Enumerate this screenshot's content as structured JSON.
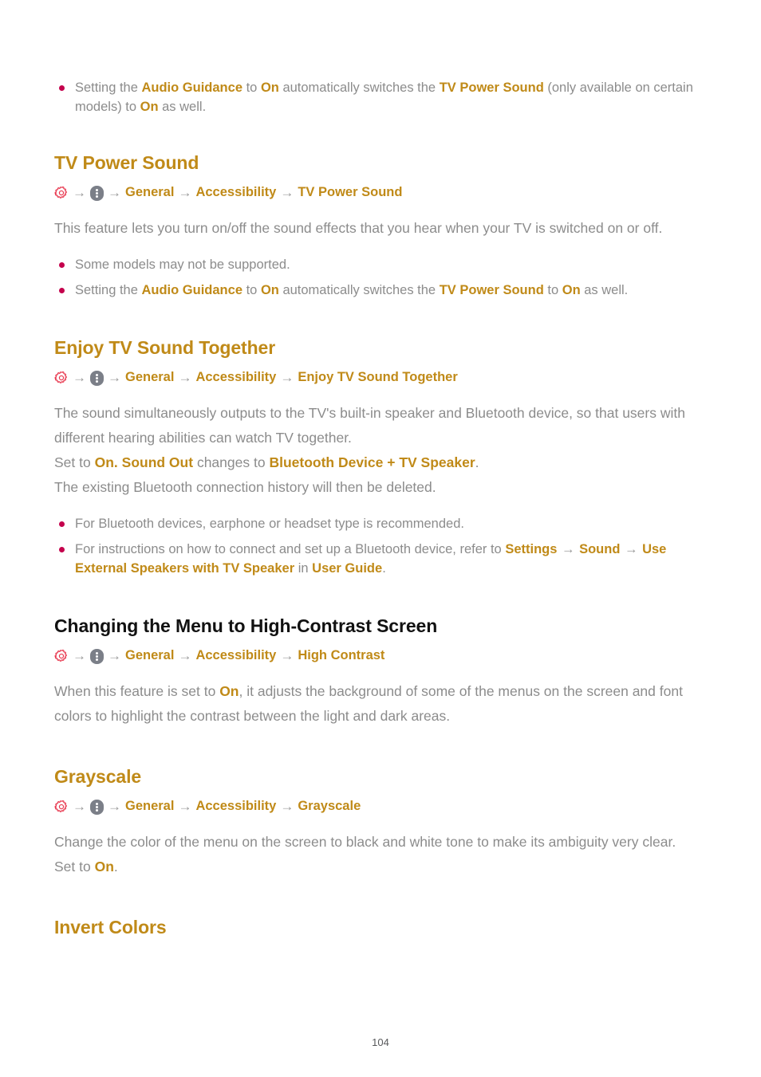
{
  "page": {
    "number": "104",
    "accent_gold": "#c08a18",
    "body_gray": "#8c8c8c",
    "bullet_crimson": "#c4004c",
    "gear_red": "#e8384f",
    "more_gray": "#7b7f88",
    "heading_black": "#111111"
  },
  "icons": {
    "gear": "gear-icon",
    "more": "more-vertical-icon",
    "arrow": "→"
  },
  "intro_bullets": [
    {
      "parts": [
        {
          "t": "Setting the ",
          "b": false
        },
        {
          "t": "Audio Guidance",
          "b": true
        },
        {
          "t": " to ",
          "b": false
        },
        {
          "t": "On",
          "b": true
        },
        {
          "t": " automatically switches the ",
          "b": false
        },
        {
          "t": "TV Power Sound",
          "b": true
        },
        {
          "t": " (only available on certain models) to ",
          "b": false
        },
        {
          "t": "On",
          "b": true
        },
        {
          "t": " as well.",
          "b": false
        }
      ]
    }
  ],
  "sections": [
    {
      "id": "tv-power-sound",
      "title": "TV Power Sound",
      "title_color": "gold",
      "breadcrumb": [
        "General",
        "Accessibility",
        "TV Power Sound"
      ],
      "paragraph": [
        {
          "t": "This feature lets you turn on/off the sound effects that you hear when your TV is switched on or off.",
          "b": false
        }
      ],
      "bullets": [
        {
          "parts": [
            {
              "t": "Some models may not be supported.",
              "b": false
            }
          ]
        },
        {
          "parts": [
            {
              "t": "Setting the ",
              "b": false
            },
            {
              "t": "Audio Guidance",
              "b": true
            },
            {
              "t": " to ",
              "b": false
            },
            {
              "t": "On",
              "b": true
            },
            {
              "t": " automatically switches the ",
              "b": false
            },
            {
              "t": "TV Power Sound",
              "b": true
            },
            {
              "t": " to ",
              "b": false
            },
            {
              "t": "On",
              "b": true
            },
            {
              "t": " as well.",
              "b": false
            }
          ]
        }
      ]
    },
    {
      "id": "enjoy-tv-sound-together",
      "title": "Enjoy TV Sound Together",
      "title_color": "gold",
      "breadcrumb": [
        "General",
        "Accessibility",
        "Enjoy TV Sound Together"
      ],
      "paragraph": [
        {
          "t": "The sound simultaneously outputs to the TV's built-in speaker and Bluetooth device, so that users with different hearing abilities can watch TV together.",
          "b": false
        },
        {
          "t": "\n",
          "b": false
        },
        {
          "t": "Set to ",
          "b": false
        },
        {
          "t": "On.",
          "b": true
        },
        {
          "t": " ",
          "b": false
        },
        {
          "t": "Sound Out",
          "b": true
        },
        {
          "t": " changes to ",
          "b": false
        },
        {
          "t": "Bluetooth Device + TV Speaker",
          "b": true
        },
        {
          "t": ".",
          "b": false
        },
        {
          "t": "\n",
          "b": false
        },
        {
          "t": "The existing Bluetooth connection history will then be deleted.",
          "b": false
        }
      ],
      "bullets": [
        {
          "parts": [
            {
              "t": "For Bluetooth devices, earphone or headset type is recommended.",
              "b": false
            }
          ]
        },
        {
          "parts": [
            {
              "t": "For instructions on how to connect and set up a Bluetooth device, refer to ",
              "b": false
            },
            {
              "t": "Settings",
              "b": true
            },
            {
              "t": " → ",
              "b": "arrow"
            },
            {
              "t": "Sound",
              "b": true
            },
            {
              "t": " → ",
              "b": "arrow"
            },
            {
              "t": "Use External Speakers with TV Speaker",
              "b": true
            },
            {
              "t": " in ",
              "b": false
            },
            {
              "t": "User Guide",
              "b": true
            },
            {
              "t": ".",
              "b": false
            }
          ]
        }
      ]
    },
    {
      "id": "high-contrast",
      "title": "Changing the Menu to High-Contrast Screen",
      "title_color": "black",
      "breadcrumb": [
        "General",
        "Accessibility",
        "High Contrast"
      ],
      "paragraph": [
        {
          "t": "When this feature is set to ",
          "b": false
        },
        {
          "t": "On",
          "b": true
        },
        {
          "t": ", it adjusts the background of some of the menus on the screen and font colors to highlight the contrast between the light and dark areas.",
          "b": false
        }
      ],
      "bullets": []
    },
    {
      "id": "grayscale",
      "title": "Grayscale",
      "title_color": "gold",
      "breadcrumb": [
        "General",
        "Accessibility",
        "Grayscale"
      ],
      "paragraph": [
        {
          "t": "Change the color of the menu on the screen to black and white tone to make its ambiguity very clear. Set to ",
          "b": false
        },
        {
          "t": "On",
          "b": true
        },
        {
          "t": ".",
          "b": false
        }
      ],
      "bullets": []
    },
    {
      "id": "invert-colors",
      "title": "Invert Colors",
      "title_color": "gold",
      "breadcrumb": null,
      "paragraph": [],
      "bullets": []
    }
  ]
}
